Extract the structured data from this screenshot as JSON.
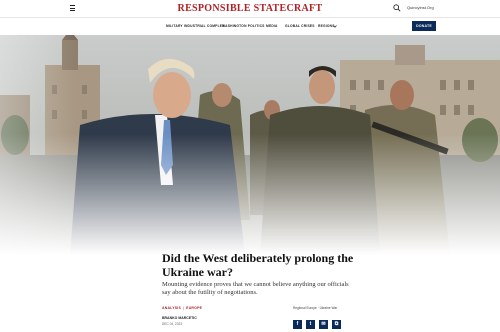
{
  "header": {
    "logo": "RESPONSIBLE STATECRAFT",
    "quincy": "QuincyInst.Org",
    "donate_label": "DONATE"
  },
  "nav": {
    "items": [
      {
        "label": "MILITARY INDUSTRIAL COMPLEX"
      },
      {
        "label": "WASHINGTON POLITICS"
      },
      {
        "label": "MEDIA"
      },
      {
        "label": "GLOBAL CRISES"
      },
      {
        "label": "REGIONS"
      }
    ]
  },
  "article": {
    "headline": "Did the West deliberately prolong the Ukraine war?",
    "dek": "Mounting evidence proves that we cannot believe anything our officials say about the futility of negotiations.",
    "tags": [
      "ANALYSIS",
      "EUROPE"
    ],
    "region": "Regional Europe · Ukraine War",
    "author": "BRANKO MARCETIC",
    "date": "DEC 04, 2023"
  },
  "share": {
    "icons": [
      "facebook-icon",
      "twitter-icon",
      "email-icon",
      "link-icon"
    ],
    "glyphs": [
      "f",
      "t",
      "✉",
      "⧉"
    ]
  },
  "colors": {
    "brand": "#b21f24",
    "navy": "#0b2a5b"
  }
}
